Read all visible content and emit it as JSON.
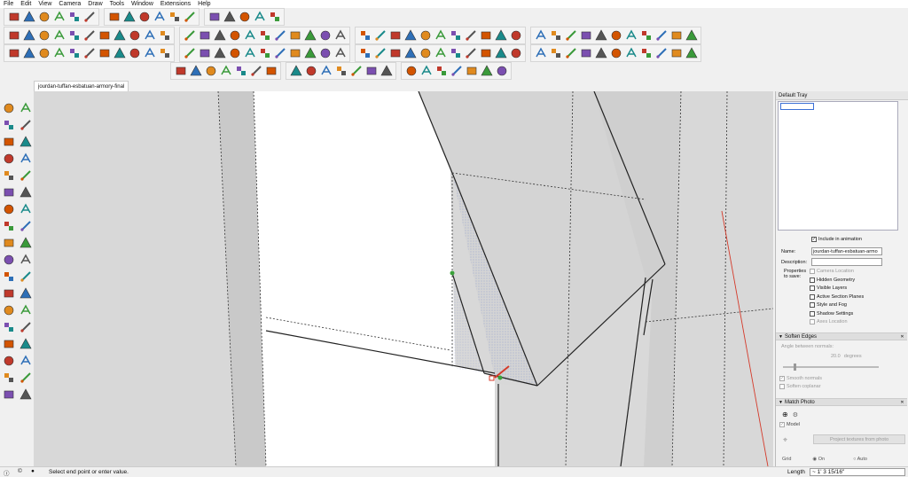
{
  "menu": [
    "File",
    "Edit",
    "View",
    "Camera",
    "Draw",
    "Tools",
    "Window",
    "Extensions",
    "Help"
  ],
  "document_tab": "jourdan-tuffan-esbatuan-armory-final",
  "tray": {
    "title": "Default Tray",
    "scenes": {
      "include_in_animation_label": "Include in animation",
      "name_label": "Name:",
      "name_value": "jourdan-tuffan-esbatuan-armo",
      "description_label": "Description:",
      "description_value": "",
      "properties_label_line1": "Properties",
      "properties_label_line2": "to save:",
      "properties": [
        {
          "label": "Camera Location",
          "checked": false,
          "enabled": false
        },
        {
          "label": "Hidden Geometry",
          "checked": false,
          "enabled": true
        },
        {
          "label": "Visible Layers",
          "checked": false,
          "enabled": true
        },
        {
          "label": "Active Section Planes",
          "checked": false,
          "enabled": true
        },
        {
          "label": "Style and Fog",
          "checked": false,
          "enabled": true
        },
        {
          "label": "Shadow Settings",
          "checked": false,
          "enabled": true
        },
        {
          "label": "Axes Location",
          "checked": false,
          "enabled": false
        }
      ]
    },
    "soften_edges": {
      "title": "Soften Edges",
      "angle_label": "Angle between normals:",
      "angle_value": "20.0",
      "angle_unit": "degrees",
      "smooth_normals": "Smooth normals",
      "soften_coplanar": "Soften coplanar"
    },
    "match_photo": {
      "title": "Match Photo",
      "model_label": "Model",
      "project_button": "Project textures from photo",
      "grid_label": "Grid",
      "grid_on": "On",
      "grid_auto": "Auto"
    }
  },
  "status": {
    "message": "Select end point or enter value.",
    "length_label": "Length",
    "length_value": "~ 1' 3 15/16\""
  },
  "colors": {
    "viewport_bg": "#dcdcdc",
    "face_white": "#ffffff",
    "face_gray": "#d9d9d9",
    "selection_blue": "#3b6fd6",
    "red_axis": "#d43a2a",
    "green_point": "#3aa13a"
  },
  "toolbars": {
    "row1_icons": [
      "iso-view-icon",
      "top-view-icon",
      "front-view-icon",
      "right-view-icon",
      "back-view-icon",
      "left-view-icon",
      "bottom-view-icon",
      "component-icon",
      "section-icon",
      "display-section-icon",
      "warehouse-icon",
      "extension-warehouse-icon",
      "share-icon",
      "model-info-icon",
      "sandbox-icon",
      "sun-icon",
      "tools-icon"
    ],
    "row2_icons": [
      "freehand-icon",
      "bezier-icon",
      "polyline-icon",
      "arc-icon",
      "circle-icon",
      "rotated-rect-icon",
      "polygon-icon",
      "offset-icon",
      "divide-icon",
      "weld-icon",
      "fillet-icon",
      "chamfer-icon",
      "extrude-icon",
      "joint-push-pull-icon",
      "round-corner-icon",
      "loft-icon",
      "curviloft-icon",
      "skin-icon",
      "shape-bender-icon",
      "fredo-scale-icon",
      "tools-on-surface-icon",
      "follow-me-icon",
      "dimension-icon",
      "text-icon",
      "axes-icon",
      "three-d-text-icon",
      "paint-bucket-icon",
      "eraser-icon",
      "tape-measure-icon",
      "protractor-icon",
      "section-plane-icon",
      "smoove-icon",
      "stamp-icon",
      "drape-icon",
      "add-detail-icon",
      "flip-edge-icon",
      "from-contours-icon",
      "from-scratch-icon",
      "animation-play-icon",
      "animation-stop-icon",
      "animation-prev-icon",
      "animation-next-icon",
      "location-icon",
      "export-icon"
    ],
    "row3_icons": [
      "layer-add-icon",
      "layer-remove-icon",
      "layer-up-icon",
      "layer-down-icon",
      "layer-lock-icon",
      "layer-color-icon",
      "layer-visible-icon",
      "layer-hide-icon",
      "layer-iso-icon",
      "layer-x-icon",
      "solid-union-icon",
      "solid-subtract-icon",
      "solid-trim-icon",
      "solid-intersect-icon",
      "solid-split-icon",
      "solid-outer-icon",
      "hidden-line-icon",
      "shaded-icon",
      "textured-icon",
      "monochrome-icon",
      "xray-icon",
      "back-edges-icon",
      "style-icon",
      "terrain-icon",
      "play-icon",
      "stop-icon",
      "previous-icon",
      "gear-icon",
      "match-photo-icon",
      "arrow-up-icon",
      "arrow-down-icon",
      "arrow-left-icon",
      "curve-icon",
      "axis-x-icon",
      "axis-y-icon",
      "axis-z-icon",
      "cut-icon",
      "scale-icon",
      "stretch-icon",
      "camera-icon",
      "walk-icon",
      "look-icon",
      "position-icon",
      "orbit-icon"
    ],
    "row4_icons": [
      "check-icon",
      "teapot-icon",
      "tape-icon",
      "window-icon",
      "table-icon",
      "copy-icon",
      "lock-icon",
      "plant-icon",
      "bridge-icon",
      "cube-icon",
      "cube-outline-icon",
      "grass-icon",
      "tree-icon",
      "sun-path-icon",
      "circle-target-icon",
      "triangle-icon",
      "line-up-icon",
      "rope-icon",
      "star-icon",
      "dome-icon",
      "cap-icon"
    ],
    "left_icons": [
      "select-icon",
      "make-component-icon",
      "paint-bucket-icon",
      "eraser-icon",
      "line-icon",
      "freehand-icon",
      "rectangle-icon",
      "rotated-rectangle-icon",
      "circle-icon",
      "polygon-icon",
      "arc-icon",
      "two-point-arc-icon",
      "three-point-arc-icon",
      "pie-icon",
      "move-icon",
      "push-pull-icon",
      "rotate-icon",
      "follow-me-icon",
      "scale-icon",
      "offset-icon",
      "tape-measure-icon",
      "dimension-icon",
      "protractor-icon",
      "text-icon",
      "axes-icon",
      "three-d-text-icon",
      "orbit-icon",
      "pan-icon",
      "zoom-icon",
      "zoom-window-icon",
      "zoom-extents-icon",
      "search-icon",
      "position-camera-icon",
      "look-around-icon",
      "walk-icon",
      "section-plane-icon"
    ]
  }
}
